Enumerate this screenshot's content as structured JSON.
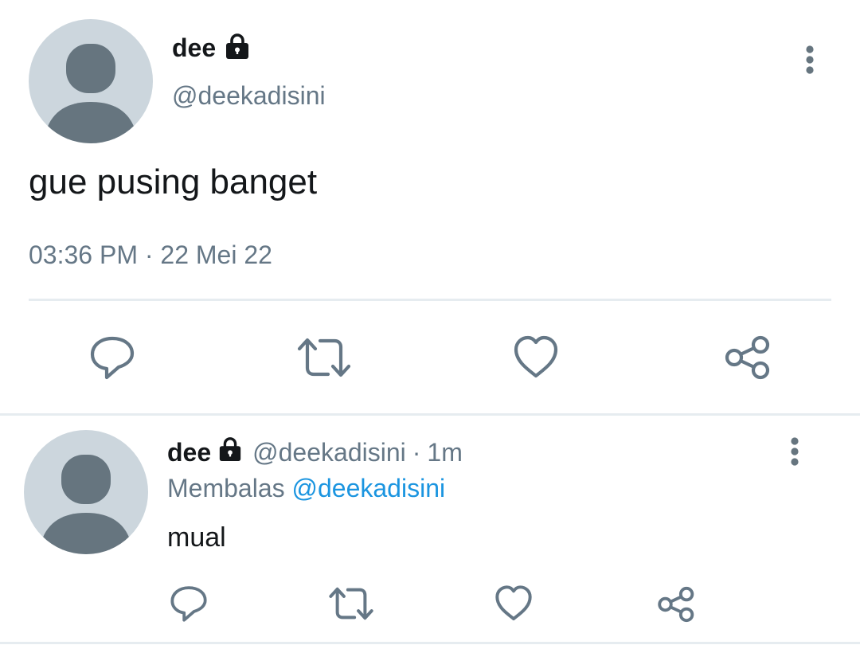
{
  "main_tweet": {
    "display_name": "dee",
    "handle": "@deekadisini",
    "text": "gue pusing banget",
    "time": "03:36 PM",
    "separator": "·",
    "date": "22 Mei 22",
    "locked": true
  },
  "actions": {
    "icons": [
      "reply-icon",
      "retweet-icon",
      "like-icon",
      "share-icon"
    ]
  },
  "reply_tweet": {
    "display_name": "dee",
    "handle": "@deekadisini",
    "separator": "·",
    "age": "1m",
    "replying_label": "Membalas",
    "replying_to": "@deekadisini",
    "text": "mual",
    "locked": true
  },
  "colors": {
    "text": "#14171a",
    "muted": "#657786",
    "link": "#1b95e0",
    "avatar_bg": "#ccd6dd",
    "avatar_fg": "#66757f",
    "divider": "#e6ecf0"
  }
}
